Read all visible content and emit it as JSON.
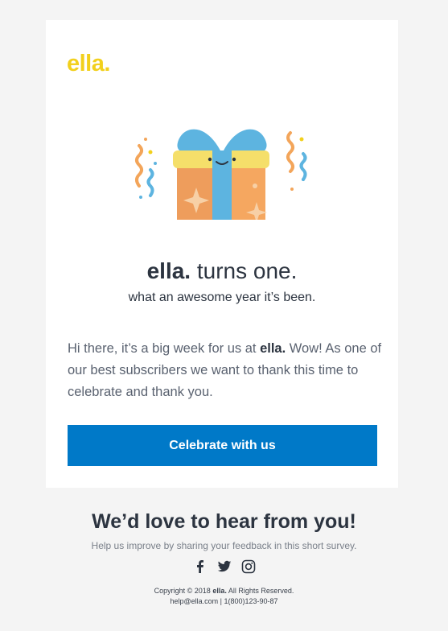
{
  "brand": {
    "logo": "ella."
  },
  "hero": {
    "brand_word": "ella.",
    "headline_rest": " turns one.",
    "subheadline": "what an awesome year it’s been."
  },
  "message": {
    "part1": "Hi there, it’s a big week for us at ",
    "brand_word": "ella.",
    "part2": " Wow! As one of our best subscribers we want to thank this time to celebrate and thank you."
  },
  "cta": {
    "label": "Celebrate with us"
  },
  "footer": {
    "title": "We’d love to hear from you!",
    "subtitle": "Help us improve by sharing your feedback in this short survey.",
    "social_icons": [
      "facebook-icon",
      "twitter-icon",
      "instagram-icon"
    ],
    "copyright_pre": "Copyright © 2018 ",
    "copyright_brand": "ella.",
    "copyright_post": " All Rights Reserved.",
    "contact": "help@ella.com | 1(800)123-90-87"
  },
  "colors": {
    "brand_yellow": "#f2d01c",
    "button_blue": "#0079c8",
    "text_dark": "#2c3440",
    "background": "#f4f4f4"
  }
}
